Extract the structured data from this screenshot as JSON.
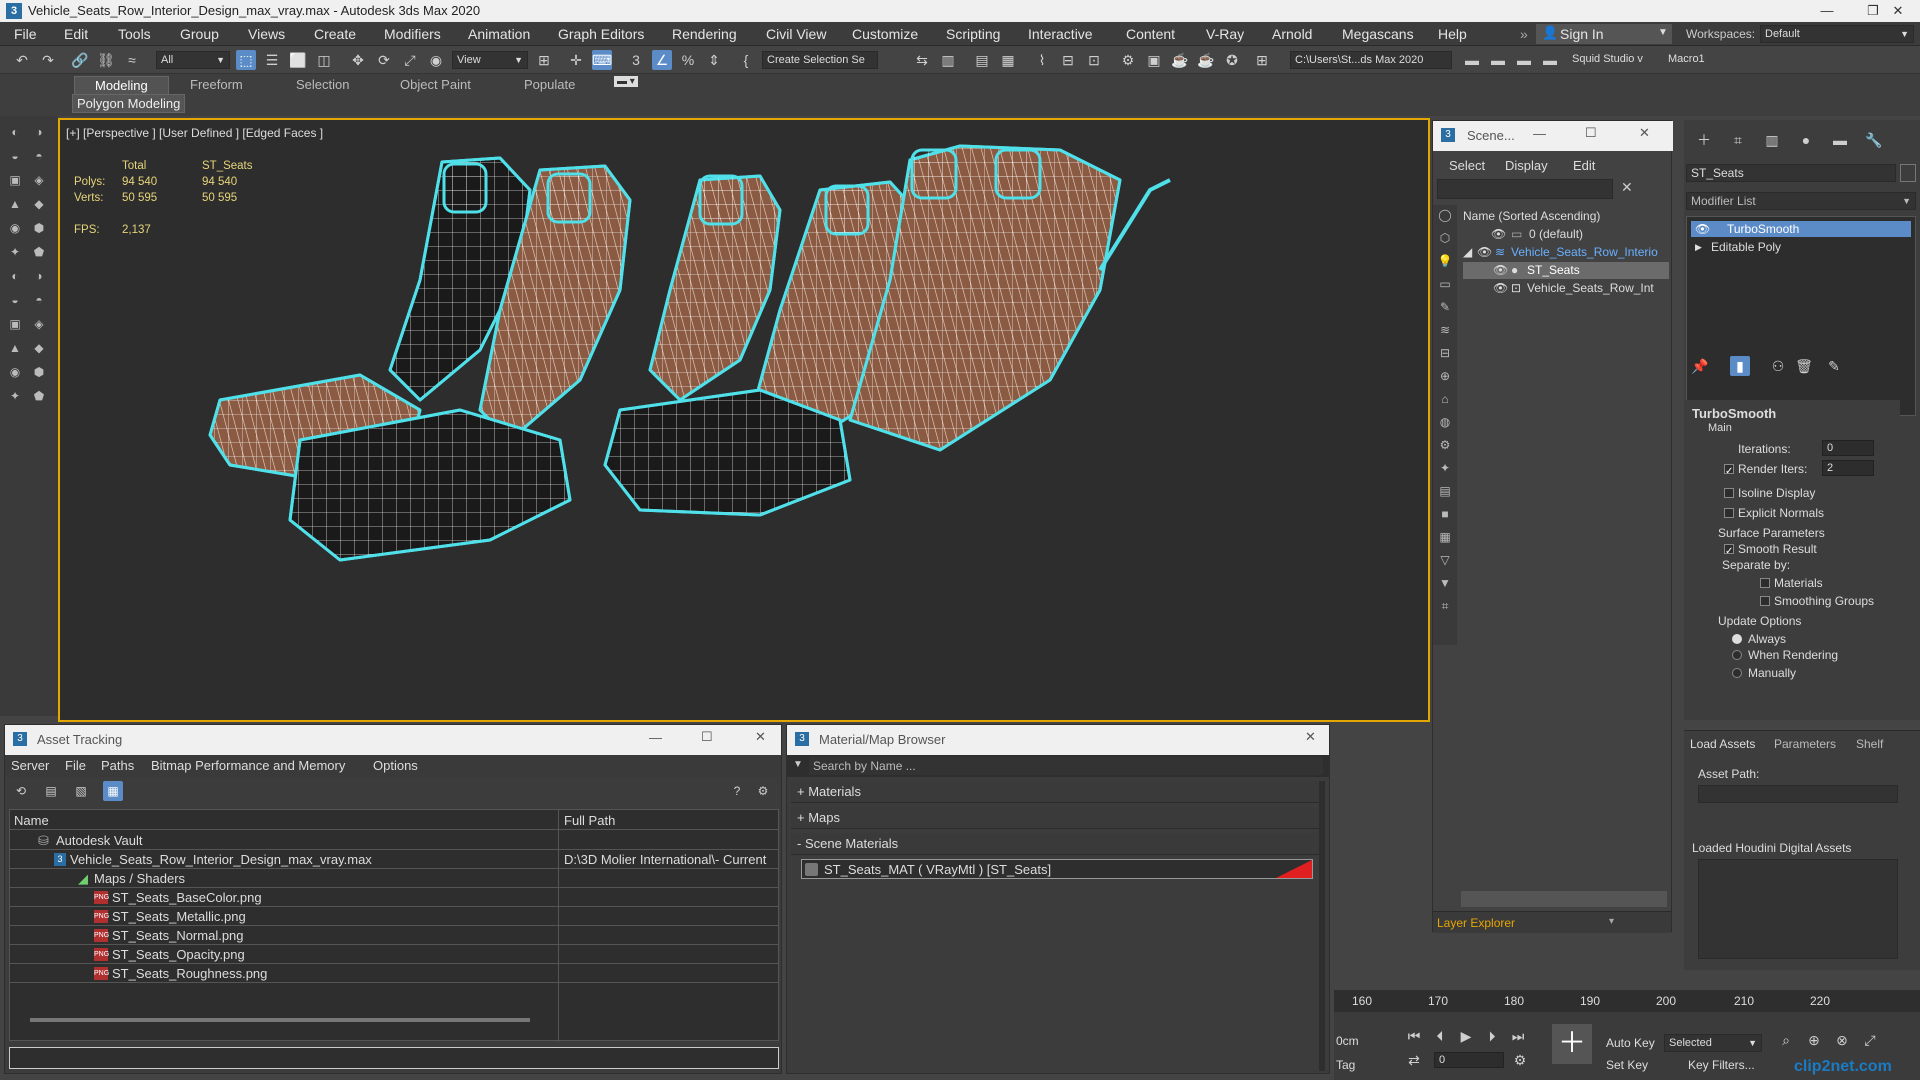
{
  "window": {
    "title": "Vehicle_Seats_Row_Interior_Design_max_vray.max - Autodesk 3ds Max 2020",
    "app_badge": "3"
  },
  "menu": [
    "File",
    "Edit",
    "Tools",
    "Group",
    "Views",
    "Create",
    "Modifiers",
    "Animation",
    "Graph Editors",
    "Rendering",
    "Civil View",
    "Customize",
    "Scripting",
    "Interactive",
    "Content",
    "V-Ray",
    "Arnold",
    "Megascans",
    "Help"
  ],
  "signin": "Sign In",
  "workspaces": {
    "label": "Workspaces:",
    "value": "Default"
  },
  "toolbar": {
    "filter": "All",
    "view": "View",
    "selection_set": "Create Selection Se",
    "path": "C:\\Users\\St...ds Max 2020",
    "squid": "Squid Studio v",
    "macro": "Macro1"
  },
  "ribbon": {
    "tabs": [
      "Modeling",
      "Freeform",
      "Selection",
      "Object Paint",
      "Populate"
    ],
    "active": "Modeling",
    "sub": "Polygon Modeling"
  },
  "viewport": {
    "label": "[+] [Perspective ] [User Defined ] [Edged Faces ]",
    "stats": {
      "col_total": "Total",
      "col_obj": "ST_Seats",
      "polys_label": "Polys:",
      "polys_total": "94 540",
      "polys_obj": "94 540",
      "verts_label": "Verts:",
      "verts_total": "50 595",
      "verts_obj": "50 595",
      "fps_label": "FPS:",
      "fps": "2,137"
    }
  },
  "scene": {
    "title": "Scene...",
    "menu": [
      "Select",
      "Display",
      "Edit"
    ],
    "header": "Name (Sorted Ascending)",
    "rows": [
      "0 (default)",
      "Vehicle_Seats_Row_Interio",
      "ST_Seats",
      "Vehicle_Seats_Row_Int"
    ],
    "footer": "Layer Explorer"
  },
  "cmd": {
    "object_name": "ST_Seats",
    "modifier_list": "Modifier List",
    "stack": [
      "TurboSmooth",
      "Editable Poly"
    ],
    "rollout": "TurboSmooth",
    "main": "Main",
    "iterations_label": "Iterations:",
    "iterations": "0",
    "render_iters_label": "Render Iters:",
    "render_iters": "2",
    "isoline": "Isoline Display",
    "explicit": "Explicit Normals",
    "surface": "Surface Parameters",
    "smooth": "Smooth Result",
    "separate": "Separate by:",
    "materials": "Materials",
    "smoothing": "Smoothing Groups",
    "update": "Update Options",
    "always": "Always",
    "when_rendering": "When Rendering",
    "manually": "Manually",
    "tabs": [
      "Load Assets",
      "Parameters",
      "Shelf"
    ],
    "asset_path": "Asset Path:",
    "loaded": "Loaded Houdini Digital Assets"
  },
  "asset": {
    "title": "Asset Tracking",
    "menu": [
      "Server",
      "File",
      "Paths",
      "Bitmap Performance and Memory",
      "Options"
    ],
    "col_name": "Name",
    "col_path": "Full Path",
    "rows": [
      {
        "name": "Autodesk Vault",
        "path": ""
      },
      {
        "name": "Vehicle_Seats_Row_Interior_Design_max_vray.max",
        "path": "D:\\3D Molier International\\- Current"
      },
      {
        "name": "Maps / Shaders",
        "path": ""
      },
      {
        "name": "ST_Seats_BaseColor.png",
        "path": ""
      },
      {
        "name": "ST_Seats_Metallic.png",
        "path": ""
      },
      {
        "name": "ST_Seats_Normal.png",
        "path": ""
      },
      {
        "name": "ST_Seats_Opacity.png",
        "path": ""
      },
      {
        "name": "ST_Seats_Roughness.png",
        "path": ""
      }
    ]
  },
  "mat": {
    "title": "Material/Map Browser",
    "search": "Search by Name ...",
    "sections": [
      "+ Materials",
      "+ Maps",
      "- Scene Materials"
    ],
    "item": "ST_Seats_MAT  ( VRayMtl )  [ST_Seats]"
  },
  "timeline": {
    "ticks": [
      "160",
      "170",
      "180",
      "190",
      "200",
      "210",
      "220"
    ],
    "unit": "0cm",
    "tag": "Tag",
    "auto_key": "Auto Key",
    "set_key": "Set Key",
    "selected": "Selected",
    "frame": "0",
    "key_filters": "Key Filters..."
  },
  "watermark": "clip2net.com"
}
